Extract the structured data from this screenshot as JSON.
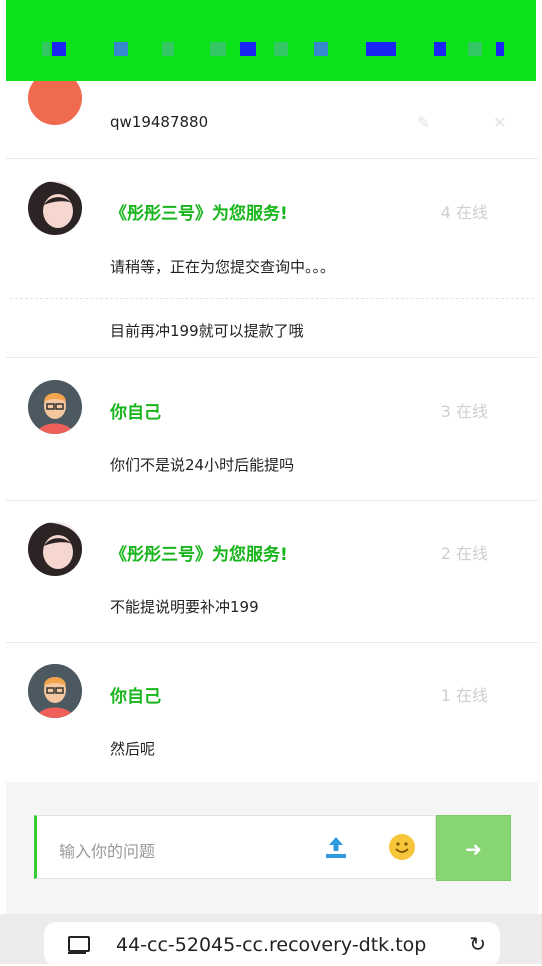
{
  "messages": [
    {
      "id": "m0",
      "name": "",
      "status": "",
      "texts": [
        "qw19487880"
      ],
      "avatar": "user-avatar"
    },
    {
      "id": "m1",
      "name": "《彤彤三号》为您服务!",
      "status": "4 在线",
      "texts": [
        "请稍等，正在为您提交查询中。。。",
        "目前再冲199就可以提款了哦"
      ],
      "avatar": "agent-avatar"
    },
    {
      "id": "m2",
      "name": "你自己",
      "status": "3 在线",
      "texts": [
        "你们不是说24小时后能提吗"
      ],
      "avatar": "user-avatar"
    },
    {
      "id": "m3",
      "name": "《彤彤三号》为您服务!",
      "status": "2 在线",
      "texts": [
        "不能提说明要补冲199"
      ],
      "avatar": "agent-avatar"
    },
    {
      "id": "m4",
      "name": "你自己",
      "status": "1 在线",
      "texts": [
        "然后呢"
      ],
      "avatar": "user-avatar"
    }
  ],
  "input": {
    "placeholder": "输入你的问题",
    "send_icon": "arrow-right-icon"
  },
  "browser": {
    "url": "44-cc-52045-cc.recovery-dtk.top"
  },
  "colors": {
    "accent": "#19b51c",
    "header": "#0be21a",
    "send": "#87d673"
  }
}
